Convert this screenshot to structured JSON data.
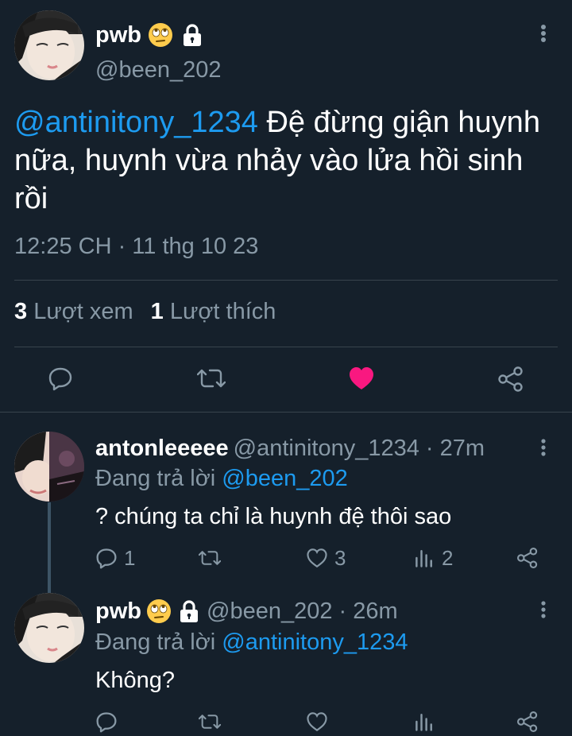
{
  "colors": {
    "background": "#15202b",
    "accent": "#1d9bf0",
    "muted": "#8899a6",
    "like": "#f91880",
    "divider": "#38444d"
  },
  "main_tweet": {
    "display_name": "pwb",
    "handle": "@been_202",
    "mention": "@antinitony_1234",
    "text": " Đệ đừng giận huynh nữa, huynh vừa nhảy vào lửa hồi sinh rồi",
    "timestamp": "12:25 CH · 11 thg 10 23",
    "views_count": "3",
    "views_label": "Lượt xem",
    "likes_count": "1",
    "likes_label": "Lượt thích",
    "liked": true,
    "actions": [
      "reply-icon",
      "retweet-icon",
      "heart-icon",
      "share-icon"
    ]
  },
  "replies": [
    {
      "display_name": "antonleeeee",
      "meta": "@antinitony_1234 · 27m",
      "replying_prefix": "Đang trả lời",
      "replying_to": "@been_202",
      "text": "? chúng ta chỉ là huynh đệ thôi sao",
      "reply_count": "1",
      "retweet_count": "",
      "like_count": "3",
      "view_count": "2"
    },
    {
      "display_name": "pwb",
      "meta": "@been_202 · 26m",
      "replying_prefix": "Đang trả lời",
      "replying_to": "@antinitony_1234",
      "text": "Không?",
      "reply_count": "",
      "retweet_count": "",
      "like_count": "",
      "view_count": ""
    }
  ]
}
